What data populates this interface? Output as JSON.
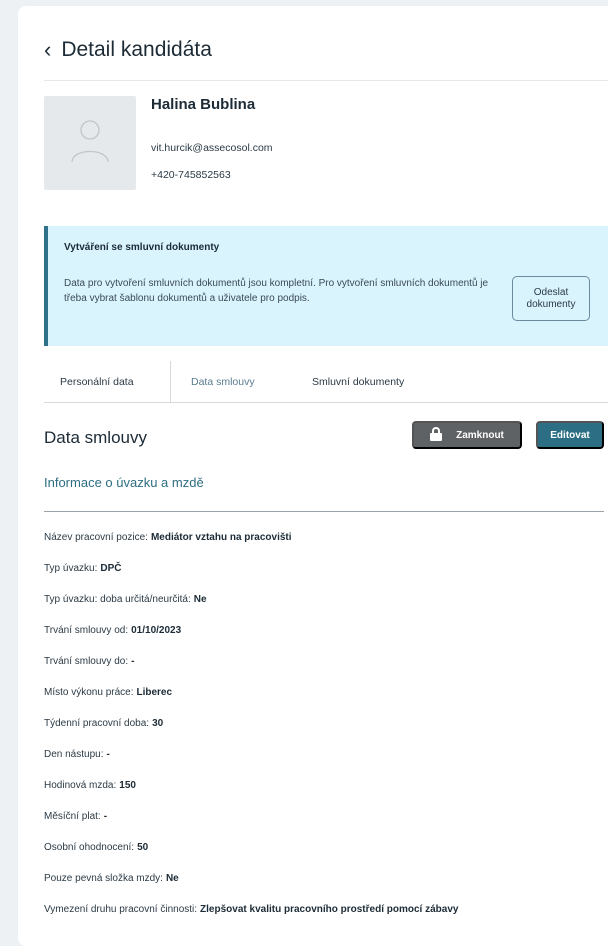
{
  "page": {
    "title": "Detail kandidáta",
    "back_icon": "chevron-left-icon"
  },
  "candidate": {
    "name": "Halina Bublina",
    "email": "vit.hurcik@assecosol.com",
    "phone": "+420-745852563",
    "avatar_icon": "user-placeholder-icon"
  },
  "alert": {
    "title": "Vytváření se smluvní dokumenty",
    "text": "Data pro vytvoření smluvních dokumentů jsou kompletní. Pro vytvoření smluvních dokumentů je třeba vybrat šablonu dokumentů a uživatele pro podpis.",
    "button_label": "Odeslat dokumenty",
    "accent": "#2e7189",
    "background": "#d9f4fd"
  },
  "tabs": [
    {
      "label": "Personální data"
    },
    {
      "label": "Data smlouvy"
    },
    {
      "label": "Smluvní dokumenty"
    }
  ],
  "section": {
    "title": "Data smlouvy",
    "lock_label": "Zamknout",
    "edit_label": "Editovat",
    "subtitle": "Informace o úvazku a mzdě"
  },
  "fields": [
    {
      "label": "Název pracovní pozice:",
      "value": "Mediátor vztahu na pracovišti"
    },
    {
      "label": "Typ úvazku:",
      "value": "DPČ"
    },
    {
      "label": "Typ úvazku: doba určitá/neurčitá:",
      "value": "Ne"
    },
    {
      "label": "Trvání smlouvy od:",
      "value": "01/10/2023"
    },
    {
      "label": "Trvání smlouvy do:",
      "value": "-"
    },
    {
      "label": "Místo výkonu práce:",
      "value": "Liberec"
    },
    {
      "label": "Týdenní pracovní doba:",
      "value": "30"
    },
    {
      "label": "Den nástupu:",
      "value": "-"
    },
    {
      "label": "Hodinová mzda:",
      "value": "150"
    },
    {
      "label": "Měsíční plat:",
      "value": "-"
    },
    {
      "label": "Osobní ohodnocení:",
      "value": "50"
    },
    {
      "label": "Pouze pevná složka mzdy:",
      "value": "Ne"
    },
    {
      "label": "Vymezení druhu pracovní činnosti:",
      "value": "Zlepšovat kvalitu pracovního prostředí pomocí zábavy"
    }
  ],
  "colors": {
    "primary": "#2c6f84",
    "lock_button": "#5f6264"
  }
}
